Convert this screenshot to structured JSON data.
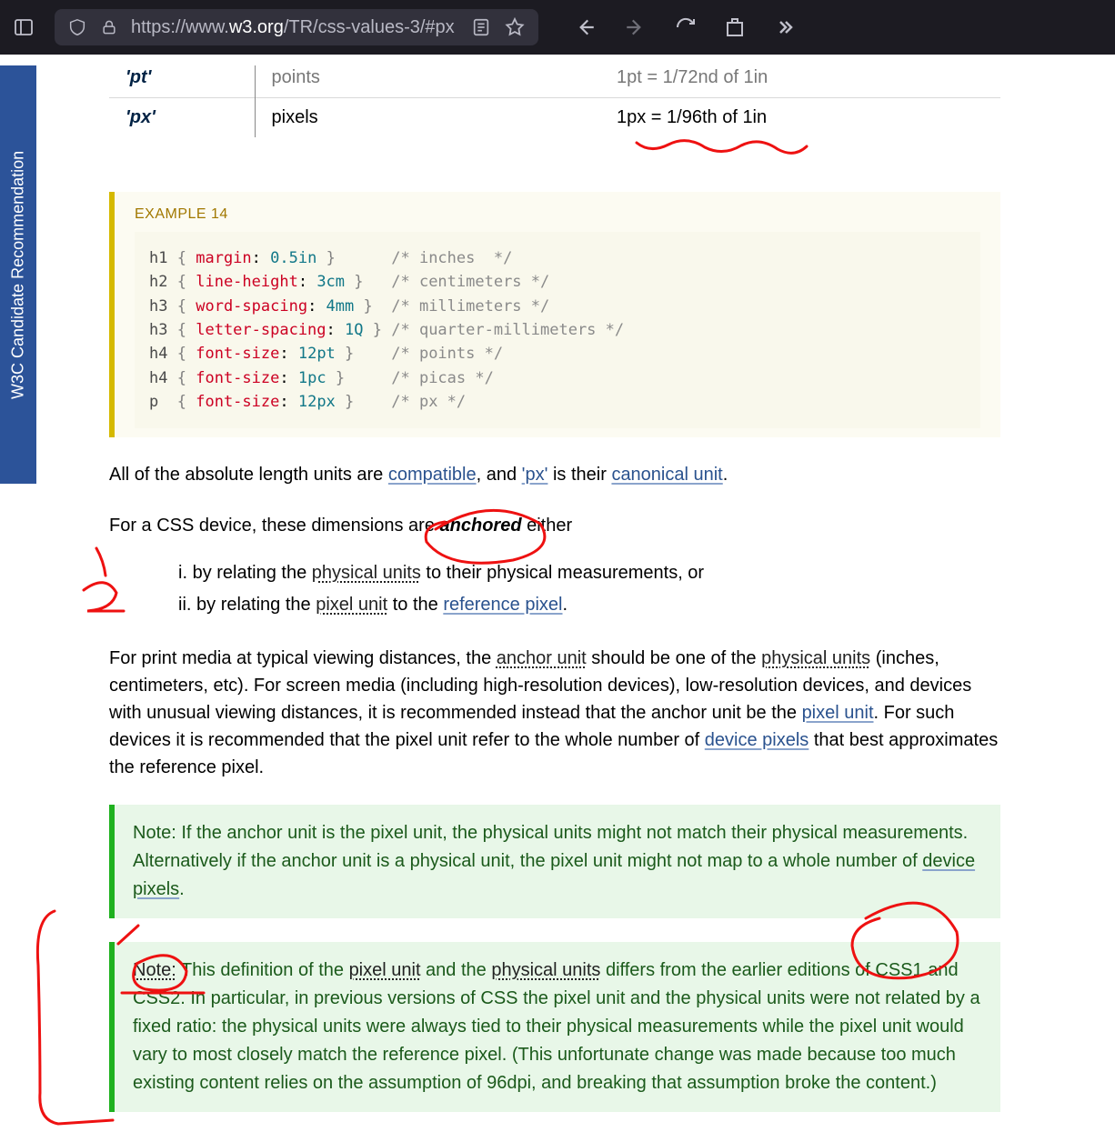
{
  "url_prefix": "https://www.",
  "url_domain": "w3.org",
  "url_path": "/TR/css-values-3/#px",
  "sidebar_label": "W3C Candidate Recommendation",
  "tbl": {
    "r0": {
      "unit": "pt",
      "name": "points",
      "desc": "1pt = 1/72nd of 1in"
    },
    "r1": {
      "unit": "px",
      "name": "pixels",
      "desc": "1px = 1/96th of 1in"
    }
  },
  "example": {
    "title": "EXAMPLE 14",
    "code_html": "<span class='t-sel'>h1</span> <span class='t-br'>{</span> <span class='t-prop'>margin</span>: <span class='t-val'>0.5in</span> <span class='t-br'>}</span>      <span class='t-com'>/* inches  */</span>\n<span class='t-sel'>h2</span> <span class='t-br'>{</span> <span class='t-prop'>line-height</span>: <span class='t-val'>3cm</span> <span class='t-br'>}</span>   <span class='t-com'>/* centimeters */</span>\n<span class='t-sel'>h3</span> <span class='t-br'>{</span> <span class='t-prop'>word-spacing</span>: <span class='t-val'>4mm</span> <span class='t-br'>}</span>  <span class='t-com'>/* millimeters */</span>\n<span class='t-sel'>h3</span> <span class='t-br'>{</span> <span class='t-prop'>letter-spacing</span>: <span class='t-val'>1Q</span> <span class='t-br'>}</span> <span class='t-com'>/* quarter-millimeters */</span>\n<span class='t-sel'>h4</span> <span class='t-br'>{</span> <span class='t-prop'>font-size</span>: <span class='t-val'>12pt</span> <span class='t-br'>}</span>    <span class='t-com'>/* points */</span>\n<span class='t-sel'>h4</span> <span class='t-br'>{</span> <span class='t-prop'>font-size</span>: <span class='t-val'>1pc</span> <span class='t-br'>}</span>     <span class='t-com'>/* picas */</span>\n<span class='t-sel'>p </span> <span class='t-br'>{</span> <span class='t-prop'>font-size</span>: <span class='t-val'>12px</span> <span class='t-br'>}</span>    <span class='t-com'>/* px */</span>"
  },
  "p1": {
    "a": "All of the absolute length units are ",
    "compat": "compatible",
    "b": ", and ",
    "px": "'px'",
    "c": " is their ",
    "canon": "canonical unit",
    "d": "."
  },
  "p2": {
    "a": "For a CSS device, these dimensions are ",
    "anch": "anchored",
    "b": " either"
  },
  "li1": {
    "a": "by relating the ",
    "pu": "physical units",
    "b": " to their physical measurements, or"
  },
  "li2": {
    "a": "by relating the ",
    "pxu": "pixel unit",
    "b": " to the ",
    "rp": "reference pixel",
    "c": "."
  },
  "p3": {
    "a": "For print media at typical viewing distances, the ",
    "au": "anchor unit",
    "b": " should be one of the ",
    "pu": "physical units",
    "c": " (inches, centimeters, etc). For screen media (including high-resolution devices), low-resolution devices, and devices with unusual viewing distances, it is recommended instead that the anchor unit be the ",
    "pxu": "pixel unit",
    "d": ". For such devices it is recommended that the pixel unit refer to the whole number of ",
    "dp": "device pixels",
    "e": " that best approximates the reference pixel."
  },
  "n1": {
    "a": "Note: If the anchor unit is the pixel unit, the physical units might not match their physical measurements. Alternatively if the anchor unit is a physical unit, the pixel unit might not map to a whole number of ",
    "dp": "device pixels",
    "b": "."
  },
  "n2": {
    "note_label": "Note:",
    "a": " This definition of the ",
    "pxu": "pixel unit",
    "b": " and the ",
    "pu": "physical units",
    "c": " differs from the earlier editions of CSS1 and CSS2. In particular, in previous versions of CSS the pixel unit and the physical units were not related by a fixed ratio: the physical units were always tied to their physical measurements while the pixel unit would vary to most closely match the reference pixel. (This unfortunate change was made because too much existing content relies on the assumption of 96dpi, and breaking that assumption broke the content.)"
  }
}
